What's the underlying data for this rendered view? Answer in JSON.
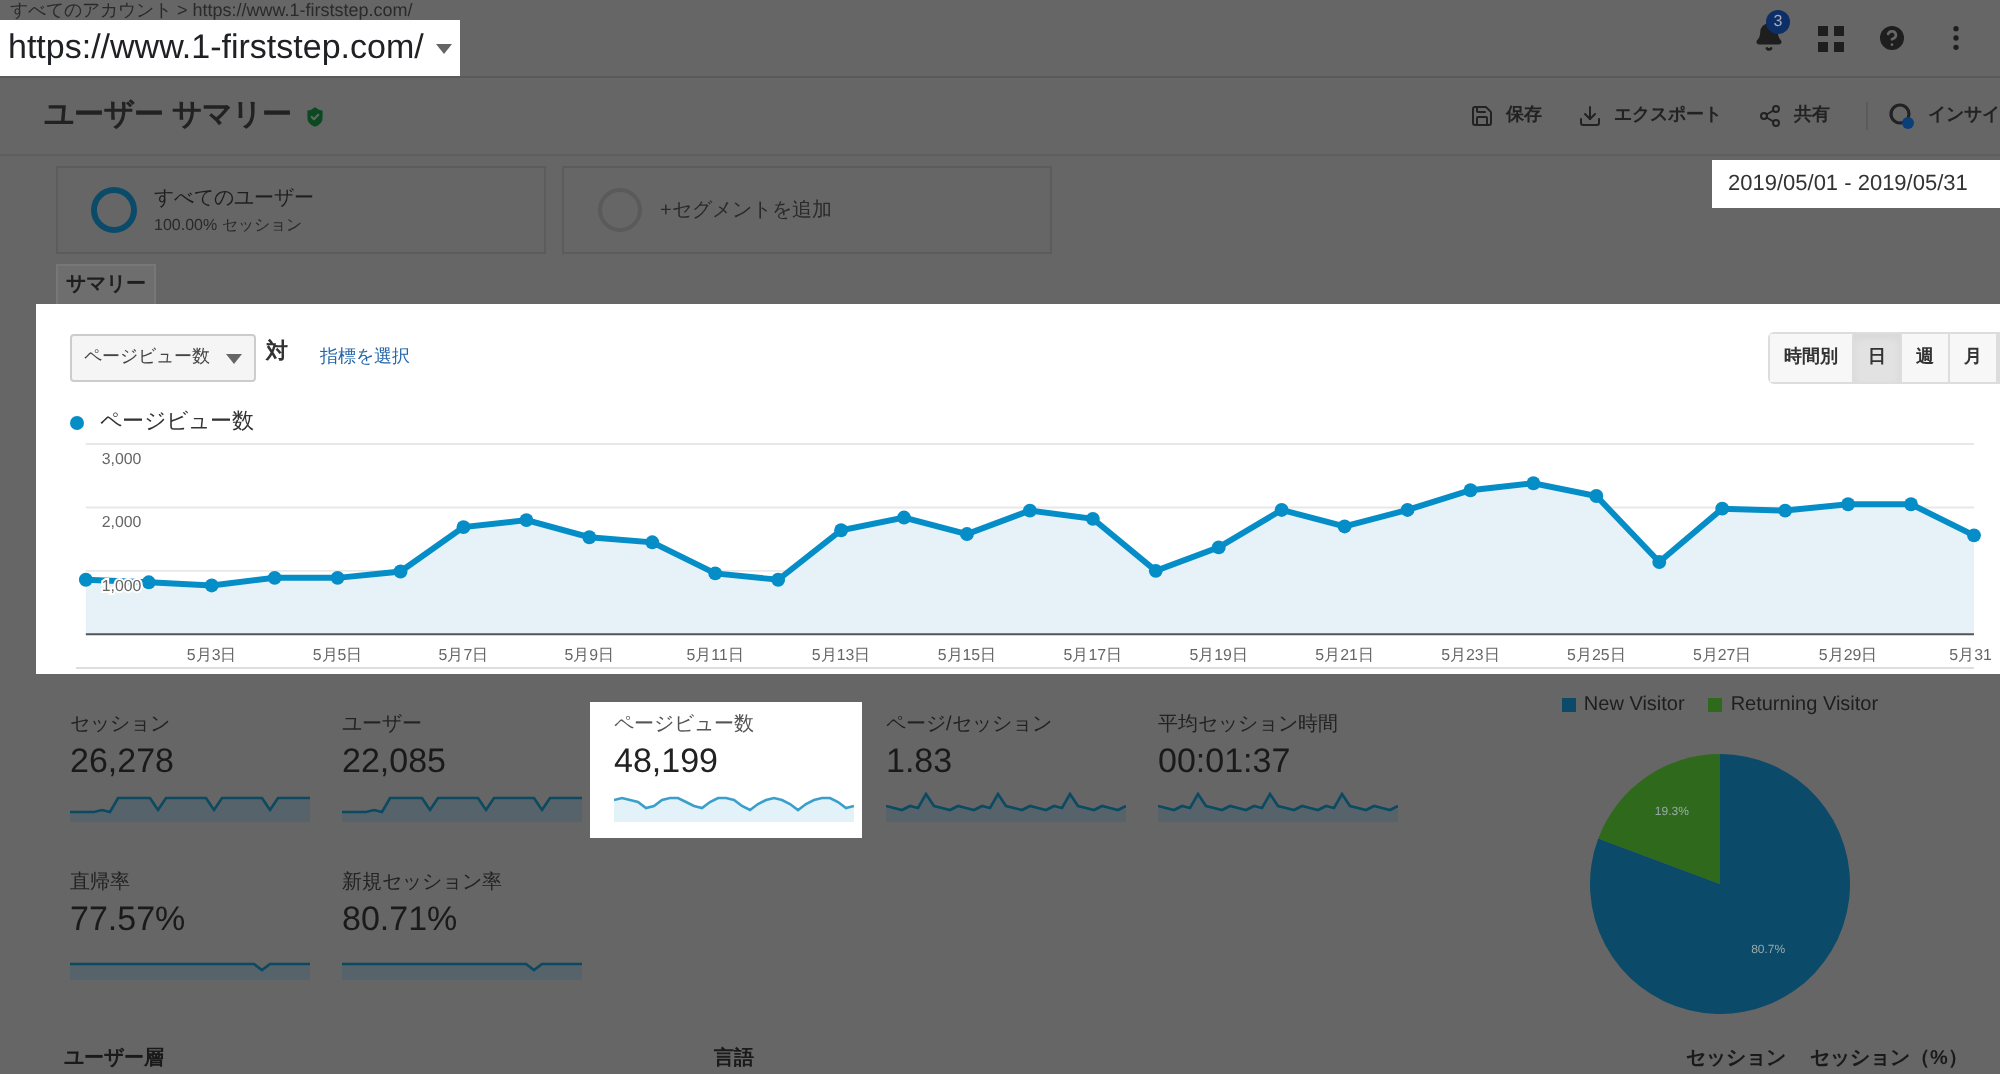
{
  "breadcrumb": "すべてのアカウント > https://www.1-firststep.com/",
  "property": {
    "name": "https://www.1-firststep.com/",
    "highlighted": true
  },
  "notifications": {
    "badge": "3"
  },
  "page_title": "ユーザー サマリー",
  "toolbar": [
    {
      "kind": "save",
      "label": "保存"
    },
    {
      "kind": "export",
      "label": "エクスポート"
    },
    {
      "kind": "share",
      "label": "共有"
    },
    {
      "kind": "insights",
      "label": "インサイ"
    }
  ],
  "segments": [
    {
      "kind": "segment",
      "title": "すべてのユーザー",
      "subtitle": "100.00% セッション"
    },
    {
      "kind": "add",
      "title": "+セグメントを追加"
    }
  ],
  "date_range": {
    "value": "2019/05/01 - 2019/05/31",
    "highlighted": true
  },
  "tabs": [
    {
      "label": "サマリー",
      "selected": true
    }
  ],
  "chart_panel": {
    "highlighted": true,
    "metric_dropdown": "ページビュー数",
    "versus": "対",
    "select_metric_link": "指標を選択",
    "granularity": [
      {
        "label": "時間別",
        "selected": false
      },
      {
        "label": "日",
        "selected": true
      },
      {
        "label": "週",
        "selected": false
      },
      {
        "label": "月",
        "selected": false
      }
    ],
    "chart_data": {
      "type": "area",
      "categories": [
        null,
        null,
        "5月3日",
        null,
        "5月5日",
        null,
        "5月7日",
        null,
        "5月9日",
        null,
        "5月11日",
        null,
        "5月13日",
        null,
        "5月15日",
        null,
        "5月17日",
        null,
        "5月19日",
        null,
        "5月21日",
        null,
        "5月23日",
        null,
        "5月25日",
        null,
        "5月27日",
        null,
        "5月29日",
        null,
        "5月31"
      ],
      "ylim": [
        0,
        3000
      ],
      "yticks": [
        {
          "value": 1000,
          "label": "1,000"
        },
        {
          "value": 2000,
          "label": "2,000"
        },
        {
          "value": 3000,
          "label": "3,000"
        }
      ],
      "series": [
        {
          "name": "ページビュー数",
          "color": "#058dc7",
          "values": [
            860,
            820,
            770,
            890,
            890,
            990,
            1690,
            1800,
            1530,
            1450,
            960,
            860,
            1640,
            1840,
            1580,
            1950,
            1820,
            1000,
            1370,
            1960,
            1700,
            1960,
            2270,
            2380,
            2180,
            1140,
            1980,
            1950,
            2050,
            2050,
            1560
          ]
        }
      ]
    }
  },
  "metrics": [
    {
      "label": "セッション",
      "value": "26,278",
      "highlighted": false
    },
    {
      "label": "ユーザー",
      "value": "22,085",
      "highlighted": false
    },
    {
      "label": "ページビュー数",
      "value": "48,199",
      "highlighted": true
    },
    {
      "label": "ページ/セッション",
      "value": "1.83",
      "highlighted": false
    },
    {
      "label": "平均セッション時間",
      "value": "00:01:37",
      "highlighted": false
    },
    {
      "label": "直帰率",
      "value": "77.57%",
      "highlighted": false
    },
    {
      "label": "新規セッション率",
      "value": "80.71%",
      "highlighted": false
    }
  ],
  "visitor_pie": {
    "chart_data": {
      "type": "pie",
      "categories": [
        "New Visitor",
        "Returning Visitor"
      ],
      "values": [
        80.7,
        19.3
      ],
      "colors": [
        "#0b4a68",
        "#2f6a1c"
      ],
      "value_labels": [
        "80.7%",
        "19.3%"
      ]
    }
  },
  "table_headers": [
    "ユーザー層",
    "言語",
    "セッション",
    "セッション（%）"
  ]
}
